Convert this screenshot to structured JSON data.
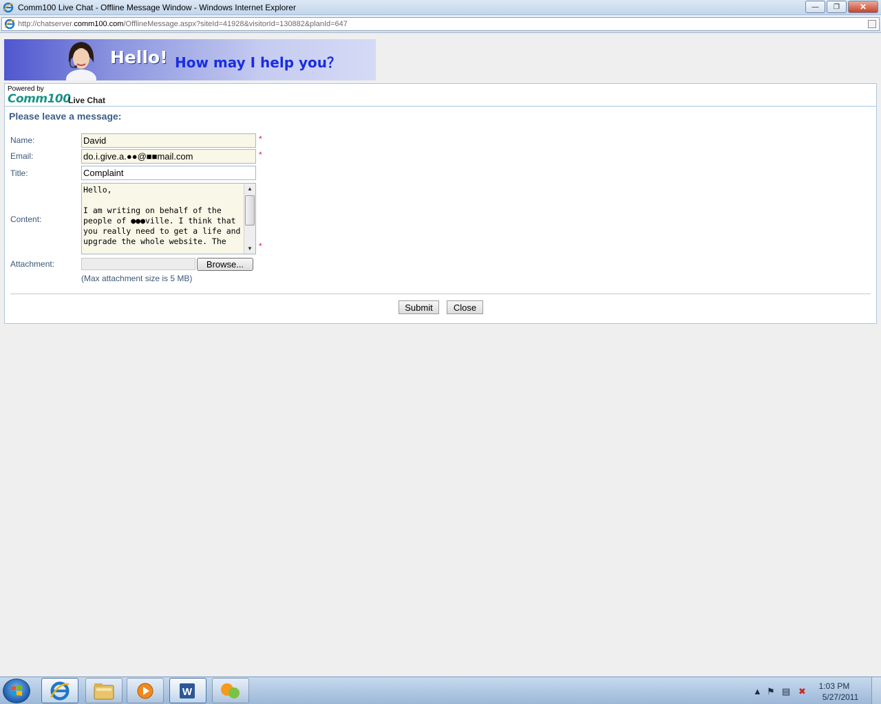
{
  "window": {
    "title": "Comm100 Live Chat - Offline Message Window - Windows Internet Explorer",
    "url_prefix": "http://chatserver.",
    "url_domain": "comm100.com",
    "url_path": "/OfflineMessage.aspx?siteId=41928&visitorId=130882&planId=647"
  },
  "banner": {
    "hello": "Hello!",
    "help": "How may I help you？"
  },
  "branding": {
    "powered_by": "Powered by",
    "logo": "Comm100",
    "live_chat": "Live Chat"
  },
  "form": {
    "heading": "Please leave a message:",
    "name_label": "Name:",
    "name_value": "David",
    "email_label": "Email:",
    "email_value": "do.i.give.a.●●@■■mail.com",
    "title_label": "Title:",
    "title_value": "Complaint",
    "content_label": "Content:",
    "content_value": "Hello,\n\nI am writing on behalf of the people of ●●●ville. I think that you really need to get a life and upgrade the whole website. The",
    "attachment_label": "Attachment:",
    "browse_label": "Browse...",
    "max_size_note": "(Max attachment size is 5 MB)",
    "required_mark": "*",
    "submit_label": "Submit",
    "close_label": "Close"
  },
  "taskbar": {
    "time": "1:03 PM",
    "date": "5/27/2011",
    "apps": [
      "internet-explorer",
      "windows-explorer",
      "media-player",
      "microsoft-word",
      "join-me"
    ]
  },
  "colors": {
    "label_blue": "#3a5778",
    "required_red": "#e01b1b",
    "required_field_bg": "#f8f7e8",
    "logo_teal": "#1b9288"
  }
}
